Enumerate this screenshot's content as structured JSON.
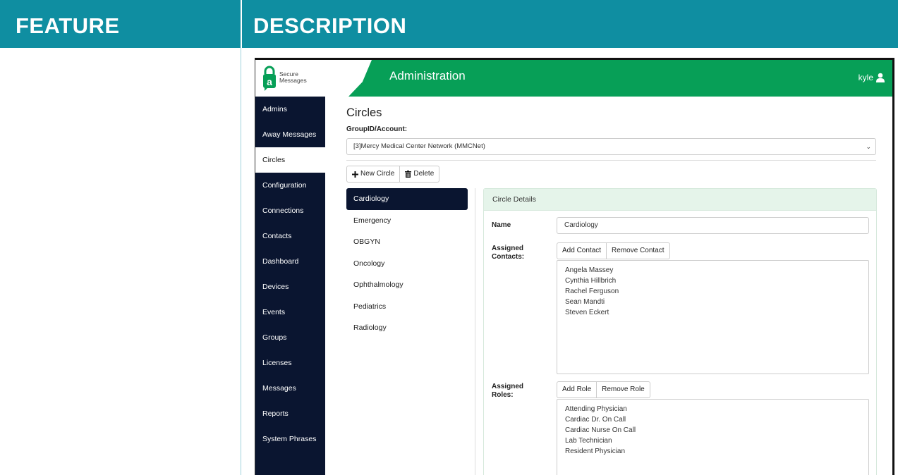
{
  "table_headers": {
    "feature": "FEATURE",
    "description": "DESCRIPTION"
  },
  "app": {
    "logo": {
      "line1": "Secure",
      "line2": "Messages"
    },
    "title": "Administration",
    "user": "kyle",
    "colors": {
      "topbar": "#079f57",
      "sidebar": "#0a1530",
      "header": "#0f8ea1"
    }
  },
  "sidebar": {
    "items": [
      {
        "label": "Admins"
      },
      {
        "label": "Away Messages"
      },
      {
        "label": "Circles"
      },
      {
        "label": "Configuration"
      },
      {
        "label": "Connections"
      },
      {
        "label": "Contacts"
      },
      {
        "label": "Dashboard"
      },
      {
        "label": "Devices"
      },
      {
        "label": "Events"
      },
      {
        "label": "Groups"
      },
      {
        "label": "Licenses"
      },
      {
        "label": "Messages"
      },
      {
        "label": "Reports"
      },
      {
        "label": "System Phrases"
      }
    ],
    "active": "Circles"
  },
  "page": {
    "title": "Circles",
    "group_label": "GroupID/Account:",
    "group_value": "[3]Mercy Medical Center Network (MMCNet)",
    "new_circle_label": "New Circle",
    "delete_label": "Delete"
  },
  "circles": {
    "items": [
      {
        "label": "Cardiology"
      },
      {
        "label": "Emergency"
      },
      {
        "label": "OBGYN"
      },
      {
        "label": "Oncology"
      },
      {
        "label": "Ophthalmology"
      },
      {
        "label": "Pediatrics"
      },
      {
        "label": "Radiology"
      }
    ],
    "active": "Cardiology"
  },
  "details": {
    "header": "Circle Details",
    "name_label": "Name",
    "name_value": "Cardiology",
    "contacts_label": "Assigned Contacts:",
    "add_contact": "Add Contact",
    "remove_contact": "Remove Contact",
    "contacts": [
      "Angela Massey",
      "Cynthia Hillbrich",
      "Rachel Ferguson",
      "Sean Mandti",
      "Steven Eckert"
    ],
    "roles_label": "Assigned Roles:",
    "add_role": "Add Role",
    "remove_role": "Remove Role",
    "roles": [
      "Attending Physician",
      "Cardiac Dr. On Call",
      "Cardiac Nurse On Call",
      "Lab Technician",
      "Resident Physician"
    ]
  }
}
